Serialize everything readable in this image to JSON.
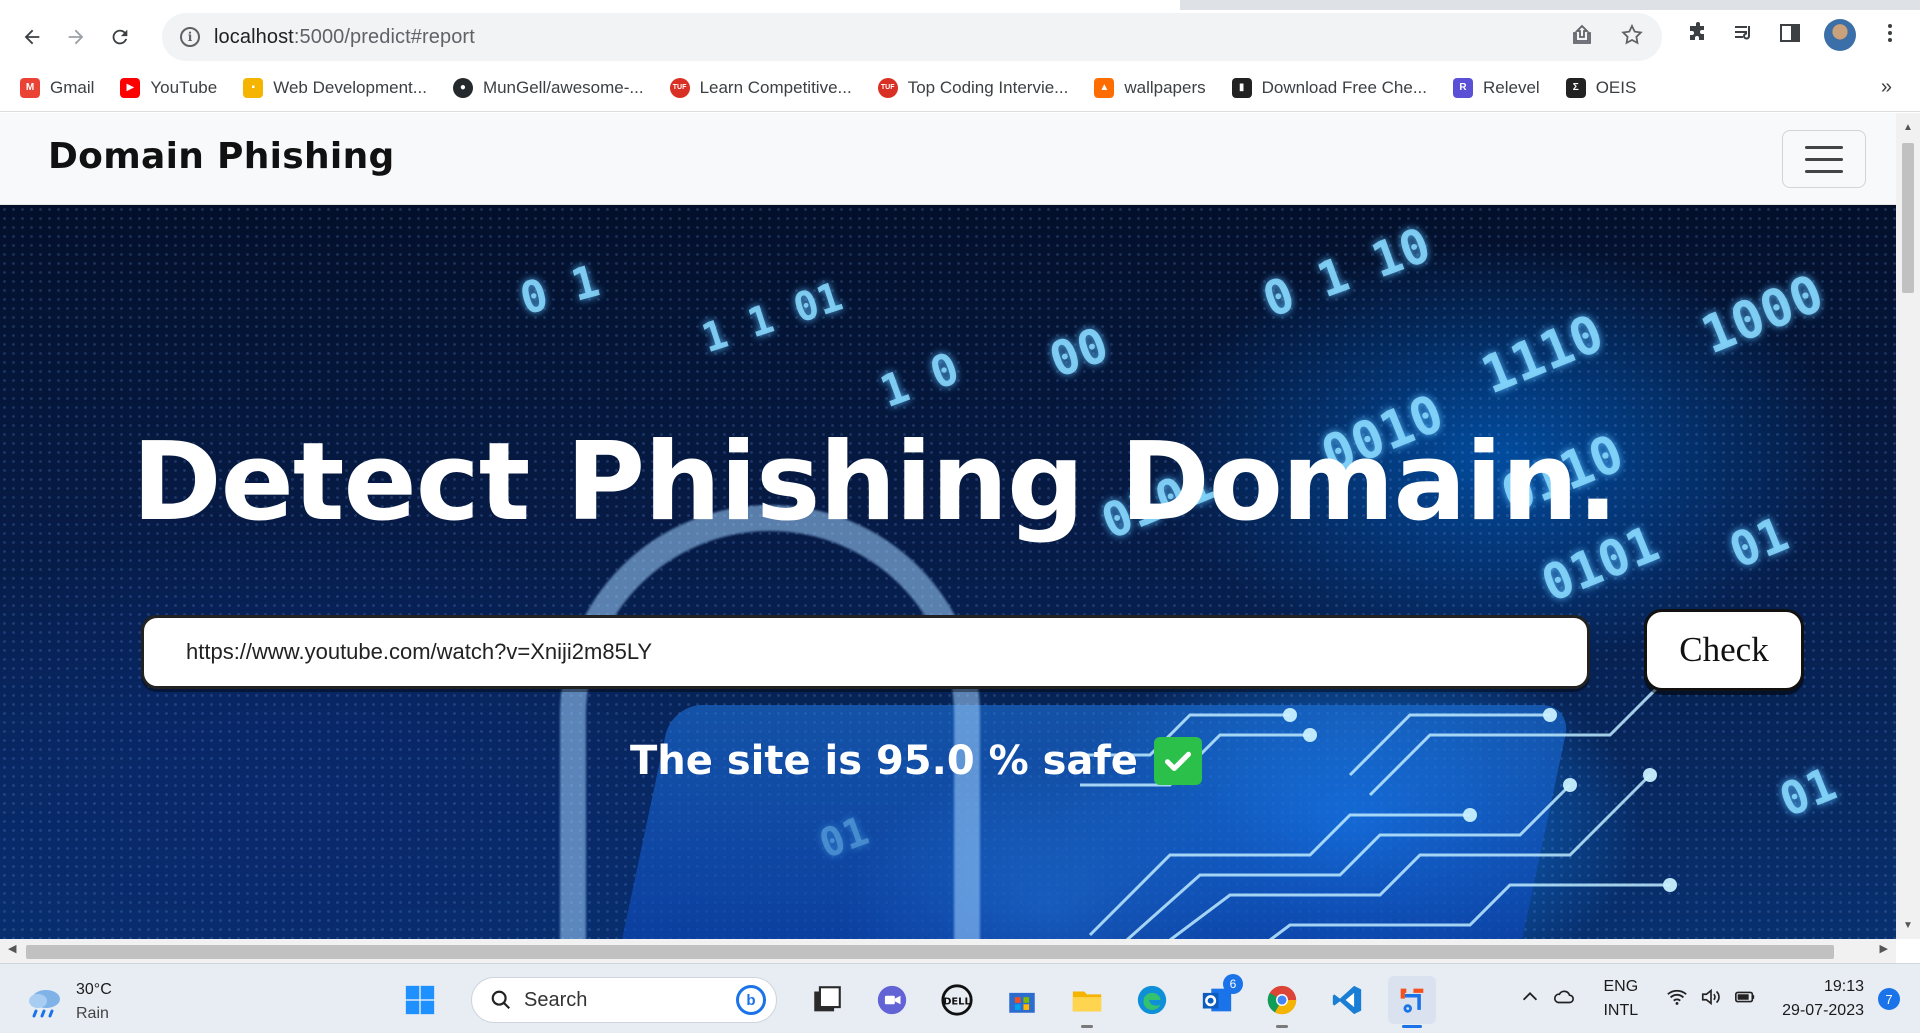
{
  "browser": {
    "url_host": "localhost",
    "url_rest": ":5000/predict#report",
    "bookmarks": [
      {
        "label": "Gmail",
        "icon": "gmail-icon",
        "color": "#ea4335"
      },
      {
        "label": "YouTube",
        "icon": "youtube-icon",
        "color": "#ff0000"
      },
      {
        "label": "Web Development...",
        "icon": "bookmark-favicon-icon",
        "color": "#f4b400"
      },
      {
        "label": "MunGell/awesome-...",
        "icon": "github-icon",
        "color": "#24292e"
      },
      {
        "label": "Learn Competitive...",
        "icon": "tuf-icon",
        "color": "#d93025"
      },
      {
        "label": "Top Coding Intervie...",
        "icon": "tuf-icon",
        "color": "#d93025"
      },
      {
        "label": "wallpapers",
        "icon": "flame-icon",
        "color": "#ff6d00"
      },
      {
        "label": "Download Free Che...",
        "icon": "book-icon",
        "color": "#222222"
      },
      {
        "label": "Relevel",
        "icon": "relevel-icon",
        "color": "#5b4fd6"
      },
      {
        "label": "OEIS",
        "icon": "oeis-icon",
        "color": "#222222"
      }
    ],
    "bookmarks_more": "»"
  },
  "page": {
    "brand": "Domain Phishing",
    "hero_title": "Detect Phishing Domain.",
    "url_input_value": "https://www.youtube.com/watch?v=Xniji2m85LY",
    "check_button": "Check",
    "result_text": "The site is 95.0 % safe"
  },
  "taskbar": {
    "weather_temp": "30°C",
    "weather_condition": "Rain",
    "search_placeholder": "Search",
    "bing_glyph": "b",
    "store_badge": "6",
    "lang_1": "ENG",
    "lang_2": "INTL",
    "time": "19:13",
    "date": "29-07-2023",
    "notifications": "7"
  },
  "colors": {
    "brand_text": "#111111",
    "safe_check": "#2bc04a",
    "accent": "#1a73e8"
  }
}
